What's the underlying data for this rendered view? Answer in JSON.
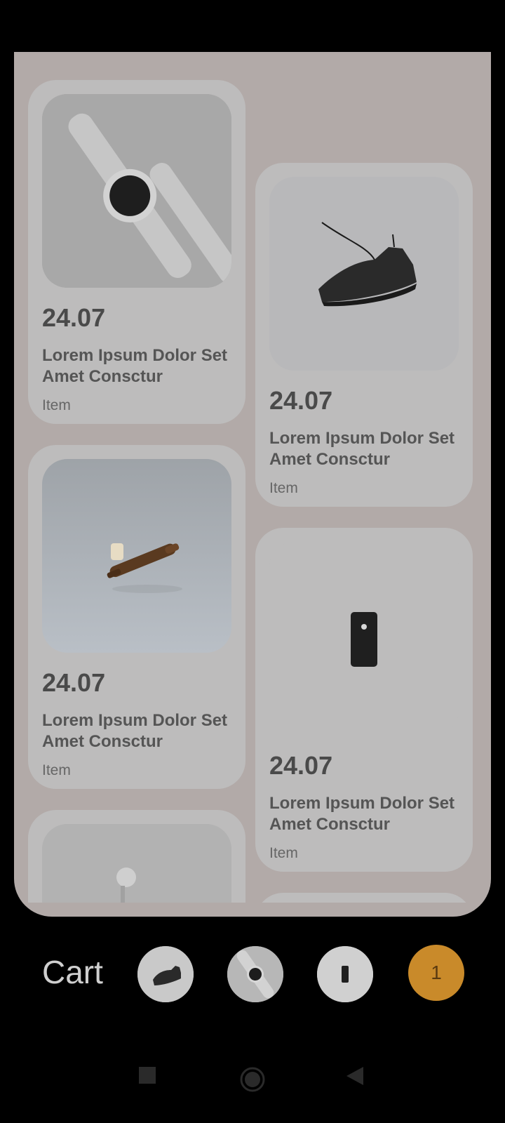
{
  "products": [
    {
      "price": "24.07",
      "title": "Lorem Ipsum Dolor Set Amet Consctur",
      "kind": "Item",
      "icon": "watch-image"
    },
    {
      "price": "24.07",
      "title": "Lorem Ipsum Dolor Set Amet Consctur",
      "kind": "Item",
      "icon": "shoe-image"
    },
    {
      "price": "24.07",
      "title": "Lorem Ipsum Dolor Set Amet Consctur",
      "kind": "Item",
      "icon": "pipe-image"
    },
    {
      "price": "24.07",
      "title": "Lorem Ipsum Dolor Set Amet Consctur",
      "kind": "Item",
      "icon": "phone-image"
    }
  ],
  "cart": {
    "label": "Cart",
    "count": "1",
    "thumbnails": [
      "shoe-thumbnail",
      "watch-thumbnail",
      "phone-thumbnail"
    ],
    "accent": "#c98a2a"
  },
  "nav": {
    "items": [
      "recents-square-icon",
      "home-circle-icon",
      "back-triangle-icon"
    ]
  }
}
